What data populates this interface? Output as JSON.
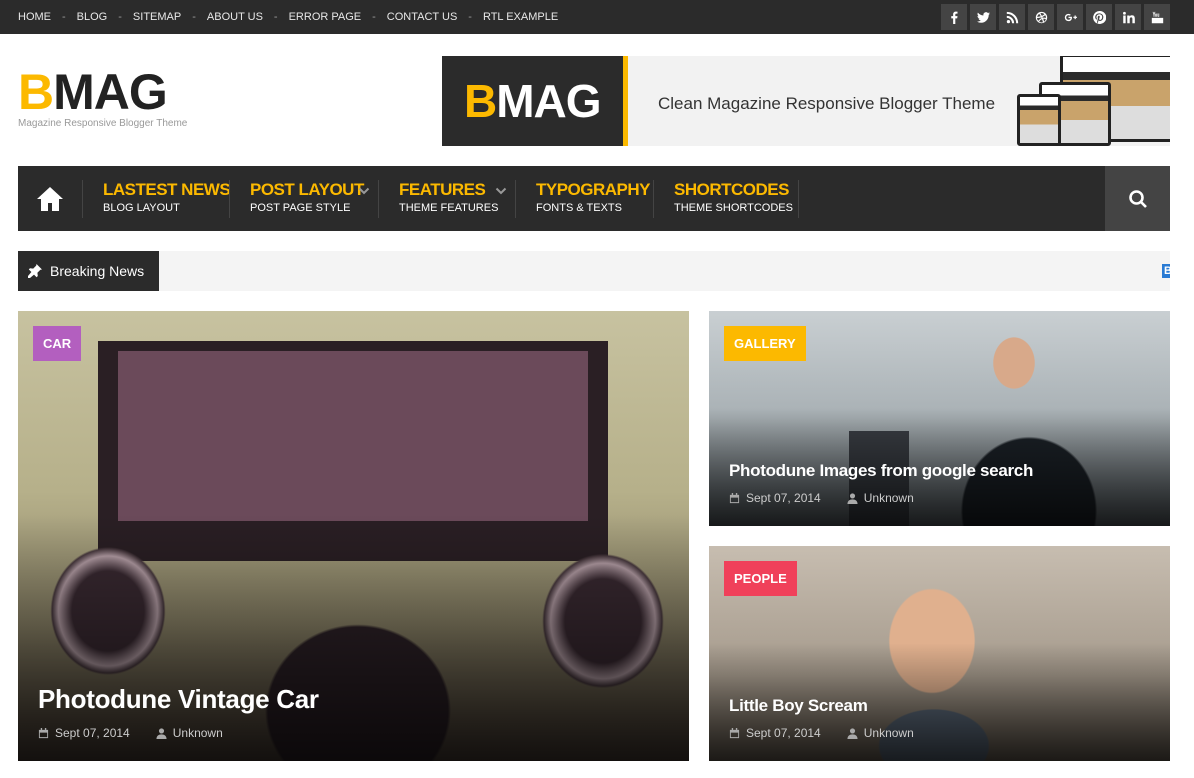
{
  "top_nav": {
    "items": [
      "HOME",
      "BLOG",
      "SITEMAP",
      "ABOUT US",
      "ERROR PAGE",
      "CONTACT US",
      "RTL EXAMPLE"
    ],
    "separator": "-"
  },
  "social": [
    "facebook-icon",
    "twitter-icon",
    "rss-icon",
    "dribbble-icon",
    "google-plus-icon",
    "pinterest-icon",
    "linkedin-icon",
    "youtube-icon"
  ],
  "logo": {
    "first_letter": "B",
    "rest": "MAG",
    "tagline": "Magazine Responsive Blogger Theme"
  },
  "banner": {
    "first_letter": "B",
    "rest": "MAG",
    "text": "Clean Magazine Responsive Blogger Theme"
  },
  "main_nav": {
    "items": [
      {
        "title": "LASTEST NEWS",
        "sub": "BLOG LAYOUT",
        "dropdown": false
      },
      {
        "title": "POST LAYOUT",
        "sub": "POST PAGE STYLE",
        "dropdown": true
      },
      {
        "title": "FEATURES",
        "sub": "THEME FEATURES",
        "dropdown": true
      },
      {
        "title": "TYPOGRAPHY",
        "sub": "FONTS & TEXTS",
        "dropdown": false
      },
      {
        "title": "SHORTCODES",
        "sub": "THEME SHORTCODES",
        "dropdown": false
      }
    ]
  },
  "breaking": {
    "label": "Breaking News",
    "ticker_edge": "B"
  },
  "posts": [
    {
      "category": "CAR",
      "category_color": "#b35fbf",
      "title": "Photodune Vintage Car",
      "date": "Sept 07, 2014",
      "author": "Unknown"
    },
    {
      "category": "GALLERY",
      "category_color": "#fcb900",
      "title": "Photodune Images from google search",
      "date": "Sept 07, 2014",
      "author": "Unknown"
    },
    {
      "category": "PEOPLE",
      "category_color": "#f0405a",
      "title": "Little Boy Scream",
      "date": "Sept 07, 2014",
      "author": "Unknown"
    }
  ],
  "colors": {
    "accent": "#fcb900",
    "dark": "#2b2b2b"
  }
}
